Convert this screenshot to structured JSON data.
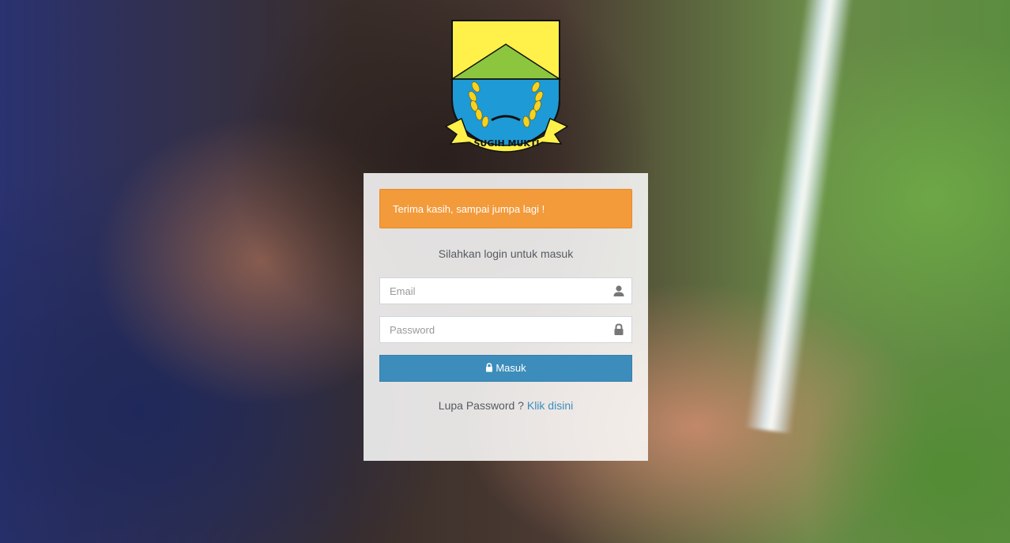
{
  "background": {
    "description_icon": "photo-background"
  },
  "logo": {
    "banner_text": "SUGIH MUKTI"
  },
  "alert": {
    "message": "Terima kasih, sampai jumpa lagi !",
    "color": "#f39a3a"
  },
  "login": {
    "intro": "Silahkan login untuk masuk",
    "email_placeholder": "Email",
    "email_value": "",
    "email_icon": "user-icon",
    "password_placeholder": "Password",
    "password_value": "",
    "password_icon": "lock-icon",
    "submit_label": "Masuk",
    "submit_icon": "lock-icon",
    "submit_color": "#3c8dbc"
  },
  "forgot": {
    "prefix": "Lupa Password ?",
    "link_label": "Klik disini"
  }
}
